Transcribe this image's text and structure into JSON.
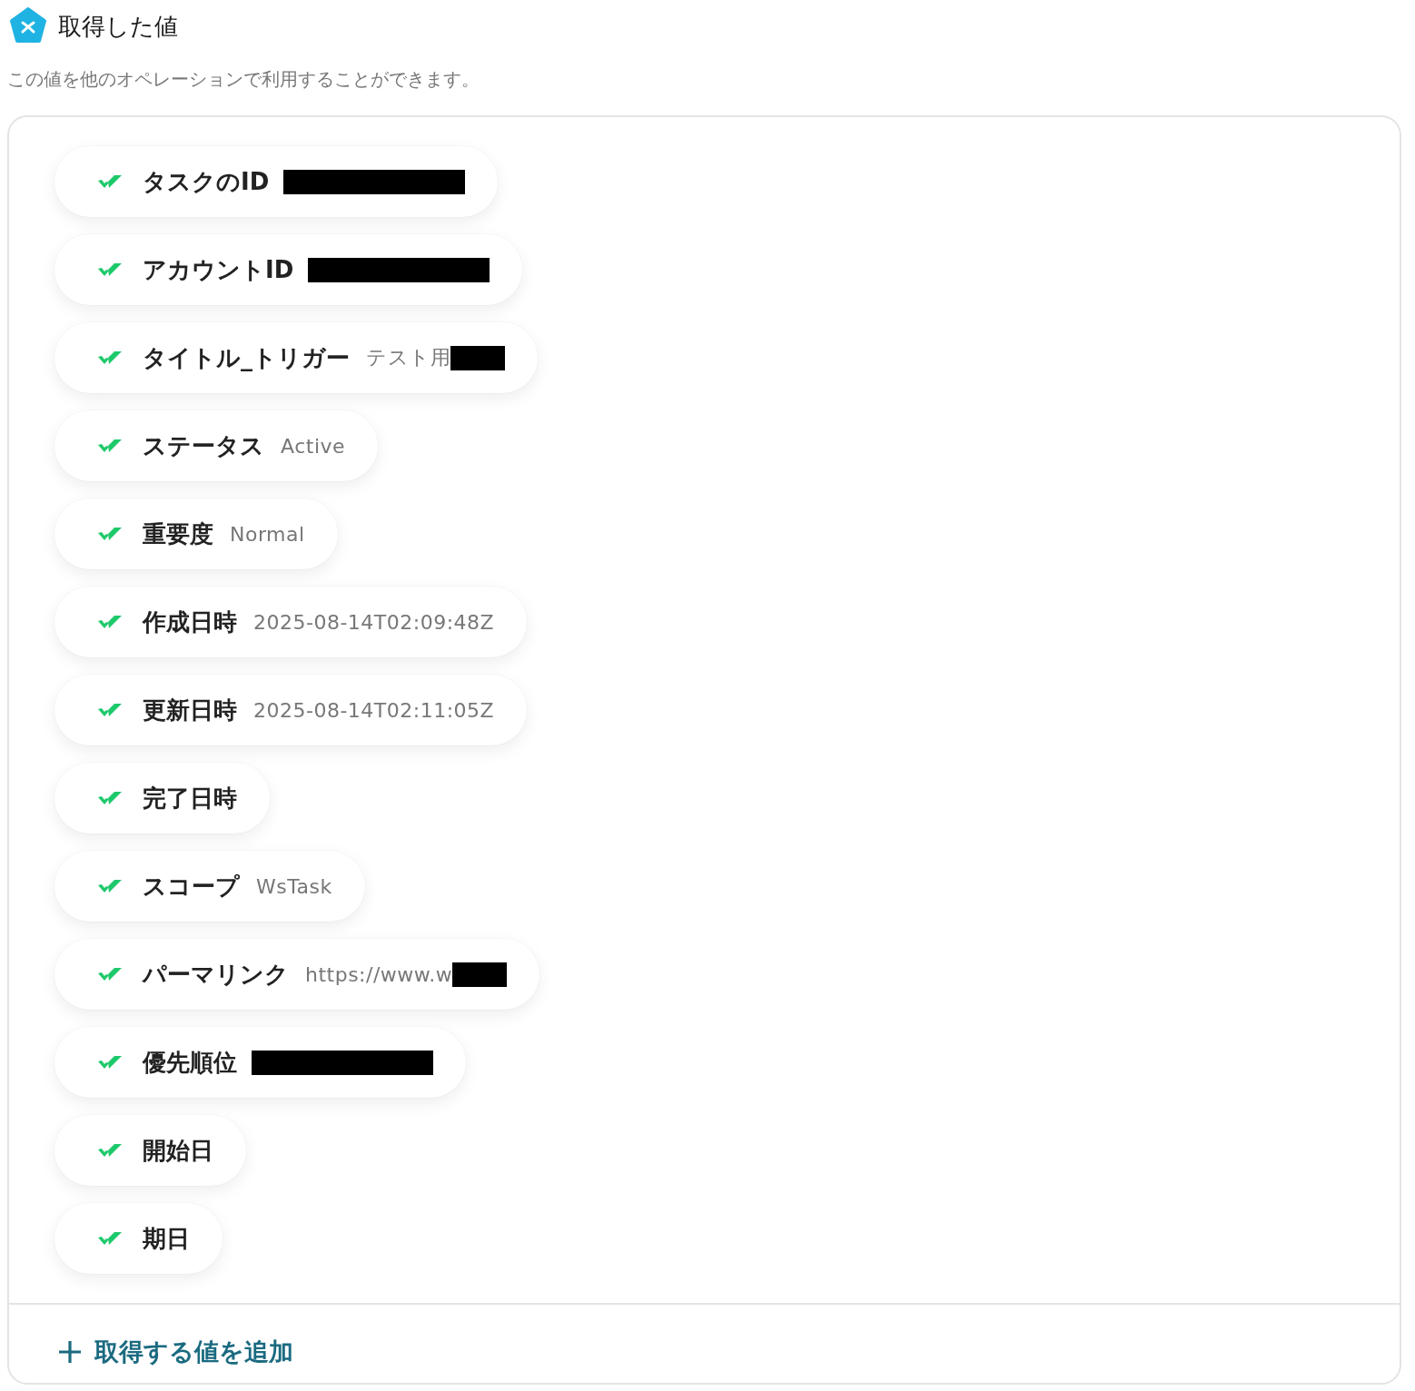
{
  "header": {
    "title": "取得した値",
    "description": "この値を他のオペレーションで利用することができます。"
  },
  "values": [
    {
      "label": "タスクのID",
      "checked": true,
      "redacted": true
    },
    {
      "label": "アカウントID",
      "checked": true,
      "redacted": true
    },
    {
      "label": "タイトル_トリガー",
      "value": "テスト用",
      "checked": true,
      "redacted": true
    },
    {
      "label": "ステータス",
      "value": "Active",
      "checked": true,
      "redacted": false
    },
    {
      "label": "重要度",
      "value": "Normal",
      "checked": true,
      "redacted": false
    },
    {
      "label": "作成日時",
      "value": "2025-08-14T02:09:48Z",
      "checked": true,
      "redacted": false
    },
    {
      "label": "更新日時",
      "value": "2025-08-14T02:11:05Z",
      "checked": true,
      "redacted": false
    },
    {
      "label": "完了日時",
      "checked": true,
      "redacted": false
    },
    {
      "label": "スコープ",
      "value": "WsTask",
      "checked": true,
      "redacted": false
    },
    {
      "label": "パーマリンク",
      "value": "https://www.w",
      "checked": true,
      "redacted": true
    },
    {
      "label": "優先順位",
      "checked": true,
      "redacted": true
    },
    {
      "label": "開始日",
      "checked": true,
      "redacted": false
    },
    {
      "label": "期日",
      "checked": true,
      "redacted": false
    }
  ],
  "add_button": {
    "label": "取得する値を追加"
  }
}
